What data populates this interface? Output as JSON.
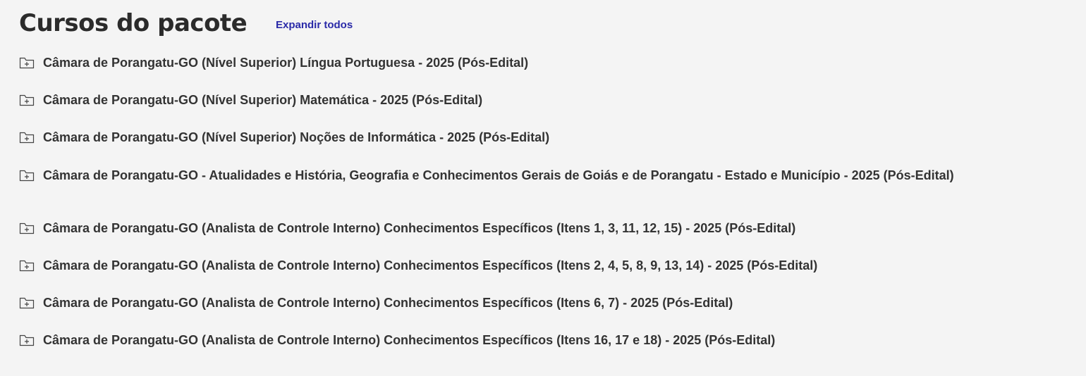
{
  "header": {
    "title": "Cursos do pacote",
    "expand_all_label": "Expandir todos"
  },
  "courses": [
    {
      "label": "Câmara de Porangatu-GO (Nível Superior) Língua Portuguesa - 2025 (Pós-Edital)",
      "icon": "folder-plus-icon"
    },
    {
      "label": "Câmara de Porangatu-GO (Nível Superior) Matemática - 2025 (Pós-Edital)",
      "icon": "folder-plus-icon"
    },
    {
      "label": "Câmara de Porangatu-GO (Nível Superior) Noções de Informática - 2025 (Pós-Edital)",
      "icon": "folder-plus-icon"
    },
    {
      "label": "Câmara de Porangatu-GO - Atualidades e História, Geografia e Conhecimentos Gerais de Goiás e de Porangatu - Estado e Município - 2025 (Pós-Edital)",
      "icon": "folder-plus-icon"
    },
    {
      "label": "Câmara de Porangatu-GO (Analista de Controle Interno) Conhecimentos Específicos (Itens 1, 3, 11, 12, 15) - 2025 (Pós-Edital)",
      "icon": "folder-plus-icon"
    },
    {
      "label": "Câmara de Porangatu-GO (Analista de Controle Interno) Conhecimentos Específicos (Itens 2, 4, 5, 8, 9, 13, 14) - 2025 (Pós-Edital)",
      "icon": "folder-plus-icon"
    },
    {
      "label": "Câmara de Porangatu-GO (Analista de Controle Interno) Conhecimentos Específicos (Itens 6, 7) - 2025 (Pós-Edital)",
      "icon": "folder-plus-icon"
    },
    {
      "label": "Câmara de Porangatu-GO (Analista de Controle Interno) Conhecimentos Específicos (Itens 16, 17 e 18) - 2025 (Pós-Edital)",
      "icon": "folder-plus-icon"
    }
  ]
}
